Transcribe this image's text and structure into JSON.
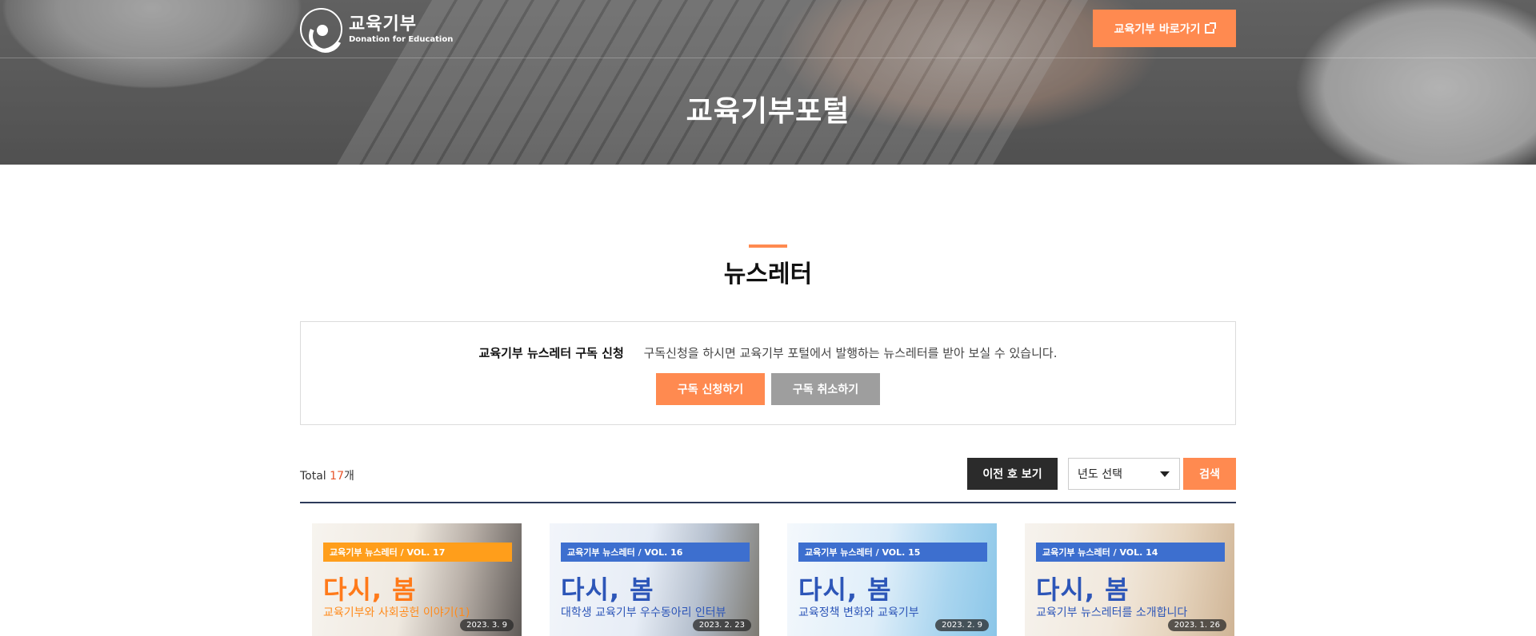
{
  "header": {
    "logo_kor": "교육기부",
    "logo_eng": "Donation for Education",
    "shortcut_label": "교육기부 바로가기",
    "page_title": "교육기부포털"
  },
  "section": {
    "title": "뉴스레터"
  },
  "subscribe": {
    "label": "교육기부 뉴스레터 구독 신청",
    "description": "구독신청을 하시면 교육기부 포털에서 발행하는 뉴스레터를 받아 보실 수 있습니다.",
    "subscribe_button": "구독 신청하기",
    "unsubscribe_button": "구독 취소하기"
  },
  "toolbar": {
    "total_prefix": "Total ",
    "total_count": "17",
    "total_suffix": "개",
    "prev_button": "이전 호 보기",
    "year_select": "년도 선택",
    "search_button": "검색"
  },
  "colors": {
    "accent": "#ff8a50",
    "dark": "#2b2b2b",
    "gray_button": "#9e9e9e",
    "divider": "#2d3a5a",
    "count_red": "#e8542a"
  },
  "cards": [
    {
      "tag": "교육기부 뉴스레터  /  VOL. 17",
      "headline": "다시, 봄",
      "subtitle": "교육기부와 사회공헌 이야기(1)",
      "date": "2023. 3. 9",
      "tag_color": "#ff9e1b",
      "headline_color": "#ff7a1a",
      "subtitle_color": "#ff8a1a"
    },
    {
      "tag": "교육기부 뉴스레터  /  VOL. 16",
      "headline": "다시, 봄",
      "subtitle": "대학생 교육기부 우수동아리 인터뷰",
      "date": "2023. 2. 23",
      "tag_color": "#3d6fcf",
      "headline_color": "#2d56b8",
      "subtitle_color": "#2d56b8"
    },
    {
      "tag": "교육기부 뉴스레터  /  VOL. 15",
      "headline": "다시, 봄",
      "subtitle": "교육정책 변화와 교육기부",
      "date": "2023. 2. 9",
      "tag_color": "#3d6fcf",
      "headline_color": "#2d56b8",
      "subtitle_color": "#2d56b8"
    },
    {
      "tag": "교육기부 뉴스레터  /  VOL. 14",
      "headline": "다시, 봄",
      "subtitle": "교육기부 뉴스레터를 소개합니다",
      "date": "2023. 1. 26",
      "tag_color": "#3d6fcf",
      "headline_color": "#2d56b8",
      "subtitle_color": "#2d56b8"
    }
  ]
}
